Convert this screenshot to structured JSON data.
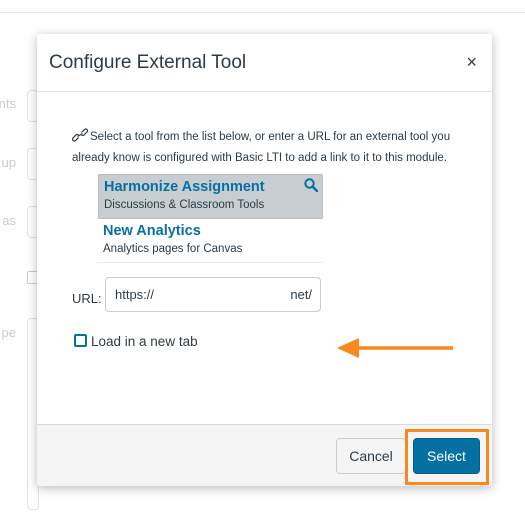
{
  "background": {
    "labels": [
      "nts",
      "up",
      "as",
      "pe"
    ]
  },
  "dialog": {
    "title": "Configure External Tool",
    "close_label": "×",
    "description": "Select a tool from the list below, or enter a URL for an external tool you already know is configured with Basic LTI to add a link to it to this module.",
    "tools": [
      {
        "name": "Harmonize Assignment",
        "description": "Discussions & Classroom Tools",
        "selected": true
      },
      {
        "name": "New Analytics",
        "description": "Analytics pages for Canvas",
        "selected": false
      }
    ],
    "url_label": "URL:",
    "url_value_start": "https://",
    "url_value_end": "net/",
    "load_new_tab_label": "Load in a new tab",
    "load_new_tab_checked": false,
    "cancel_label": "Cancel",
    "select_label": "Select"
  },
  "colors": {
    "accent": "#0770a3",
    "highlight": "#f7891f",
    "selected_bg": "#c7cdd1"
  }
}
